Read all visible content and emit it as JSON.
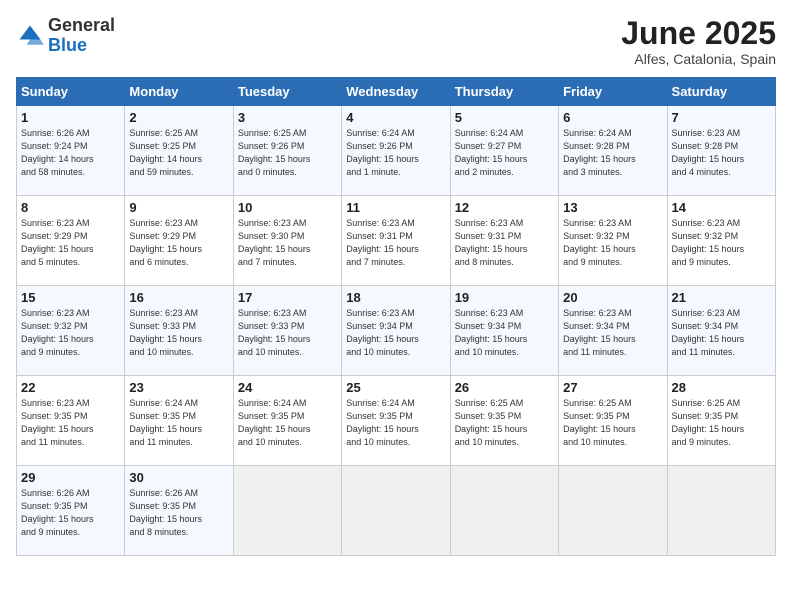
{
  "logo": {
    "general": "General",
    "blue": "Blue"
  },
  "header": {
    "title": "June 2025",
    "subtitle": "Alfes, Catalonia, Spain"
  },
  "weekdays": [
    "Sunday",
    "Monday",
    "Tuesday",
    "Wednesday",
    "Thursday",
    "Friday",
    "Saturday"
  ],
  "weeks": [
    [
      {
        "day": "1",
        "info": "Sunrise: 6:26 AM\nSunset: 9:24 PM\nDaylight: 14 hours\nand 58 minutes."
      },
      {
        "day": "2",
        "info": "Sunrise: 6:25 AM\nSunset: 9:25 PM\nDaylight: 14 hours\nand 59 minutes."
      },
      {
        "day": "3",
        "info": "Sunrise: 6:25 AM\nSunset: 9:26 PM\nDaylight: 15 hours\nand 0 minutes."
      },
      {
        "day": "4",
        "info": "Sunrise: 6:24 AM\nSunset: 9:26 PM\nDaylight: 15 hours\nand 1 minute."
      },
      {
        "day": "5",
        "info": "Sunrise: 6:24 AM\nSunset: 9:27 PM\nDaylight: 15 hours\nand 2 minutes."
      },
      {
        "day": "6",
        "info": "Sunrise: 6:24 AM\nSunset: 9:28 PM\nDaylight: 15 hours\nand 3 minutes."
      },
      {
        "day": "7",
        "info": "Sunrise: 6:23 AM\nSunset: 9:28 PM\nDaylight: 15 hours\nand 4 minutes."
      }
    ],
    [
      {
        "day": "8",
        "info": "Sunrise: 6:23 AM\nSunset: 9:29 PM\nDaylight: 15 hours\nand 5 minutes."
      },
      {
        "day": "9",
        "info": "Sunrise: 6:23 AM\nSunset: 9:29 PM\nDaylight: 15 hours\nand 6 minutes."
      },
      {
        "day": "10",
        "info": "Sunrise: 6:23 AM\nSunset: 9:30 PM\nDaylight: 15 hours\nand 7 minutes."
      },
      {
        "day": "11",
        "info": "Sunrise: 6:23 AM\nSunset: 9:31 PM\nDaylight: 15 hours\nand 7 minutes."
      },
      {
        "day": "12",
        "info": "Sunrise: 6:23 AM\nSunset: 9:31 PM\nDaylight: 15 hours\nand 8 minutes."
      },
      {
        "day": "13",
        "info": "Sunrise: 6:23 AM\nSunset: 9:32 PM\nDaylight: 15 hours\nand 9 minutes."
      },
      {
        "day": "14",
        "info": "Sunrise: 6:23 AM\nSunset: 9:32 PM\nDaylight: 15 hours\nand 9 minutes."
      }
    ],
    [
      {
        "day": "15",
        "info": "Sunrise: 6:23 AM\nSunset: 9:32 PM\nDaylight: 15 hours\nand 9 minutes."
      },
      {
        "day": "16",
        "info": "Sunrise: 6:23 AM\nSunset: 9:33 PM\nDaylight: 15 hours\nand 10 minutes."
      },
      {
        "day": "17",
        "info": "Sunrise: 6:23 AM\nSunset: 9:33 PM\nDaylight: 15 hours\nand 10 minutes."
      },
      {
        "day": "18",
        "info": "Sunrise: 6:23 AM\nSunset: 9:34 PM\nDaylight: 15 hours\nand 10 minutes."
      },
      {
        "day": "19",
        "info": "Sunrise: 6:23 AM\nSunset: 9:34 PM\nDaylight: 15 hours\nand 10 minutes."
      },
      {
        "day": "20",
        "info": "Sunrise: 6:23 AM\nSunset: 9:34 PM\nDaylight: 15 hours\nand 11 minutes."
      },
      {
        "day": "21",
        "info": "Sunrise: 6:23 AM\nSunset: 9:34 PM\nDaylight: 15 hours\nand 11 minutes."
      }
    ],
    [
      {
        "day": "22",
        "info": "Sunrise: 6:23 AM\nSunset: 9:35 PM\nDaylight: 15 hours\nand 11 minutes."
      },
      {
        "day": "23",
        "info": "Sunrise: 6:24 AM\nSunset: 9:35 PM\nDaylight: 15 hours\nand 11 minutes."
      },
      {
        "day": "24",
        "info": "Sunrise: 6:24 AM\nSunset: 9:35 PM\nDaylight: 15 hours\nand 10 minutes."
      },
      {
        "day": "25",
        "info": "Sunrise: 6:24 AM\nSunset: 9:35 PM\nDaylight: 15 hours\nand 10 minutes."
      },
      {
        "day": "26",
        "info": "Sunrise: 6:25 AM\nSunset: 9:35 PM\nDaylight: 15 hours\nand 10 minutes."
      },
      {
        "day": "27",
        "info": "Sunrise: 6:25 AM\nSunset: 9:35 PM\nDaylight: 15 hours\nand 10 minutes."
      },
      {
        "day": "28",
        "info": "Sunrise: 6:25 AM\nSunset: 9:35 PM\nDaylight: 15 hours\nand 9 minutes."
      }
    ],
    [
      {
        "day": "29",
        "info": "Sunrise: 6:26 AM\nSunset: 9:35 PM\nDaylight: 15 hours\nand 9 minutes."
      },
      {
        "day": "30",
        "info": "Sunrise: 6:26 AM\nSunset: 9:35 PM\nDaylight: 15 hours\nand 8 minutes."
      },
      {
        "day": "",
        "info": ""
      },
      {
        "day": "",
        "info": ""
      },
      {
        "day": "",
        "info": ""
      },
      {
        "day": "",
        "info": ""
      },
      {
        "day": "",
        "info": ""
      }
    ]
  ]
}
